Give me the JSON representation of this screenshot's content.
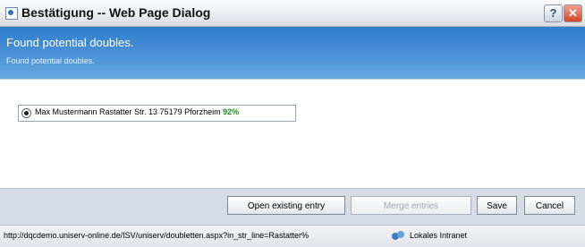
{
  "window": {
    "title": "Bestätigung -- Web Page Dialog",
    "help_label": "?",
    "close_label": "✕"
  },
  "header": {
    "title": "Found potential doubles.",
    "subtitle": "Found potential doubles."
  },
  "candidates": [
    {
      "text": "Max Mustermann Rastatter Str. 13 75179 Pforzheim",
      "score": "92%",
      "selected": true
    }
  ],
  "buttons": {
    "open_existing": "Open existing entry",
    "merge": "Merge entries",
    "save": "Save",
    "cancel": "Cancel"
  },
  "statusbar": {
    "url": "http://dqcdemo.uniserv-online.de/ISV/uniserv/doubletten.aspx?in_str_line=Rastatter%",
    "zone": "Lokales Intranet"
  },
  "colors": {
    "header_bg": "#4e94d8",
    "score": "#1b8a1b"
  }
}
